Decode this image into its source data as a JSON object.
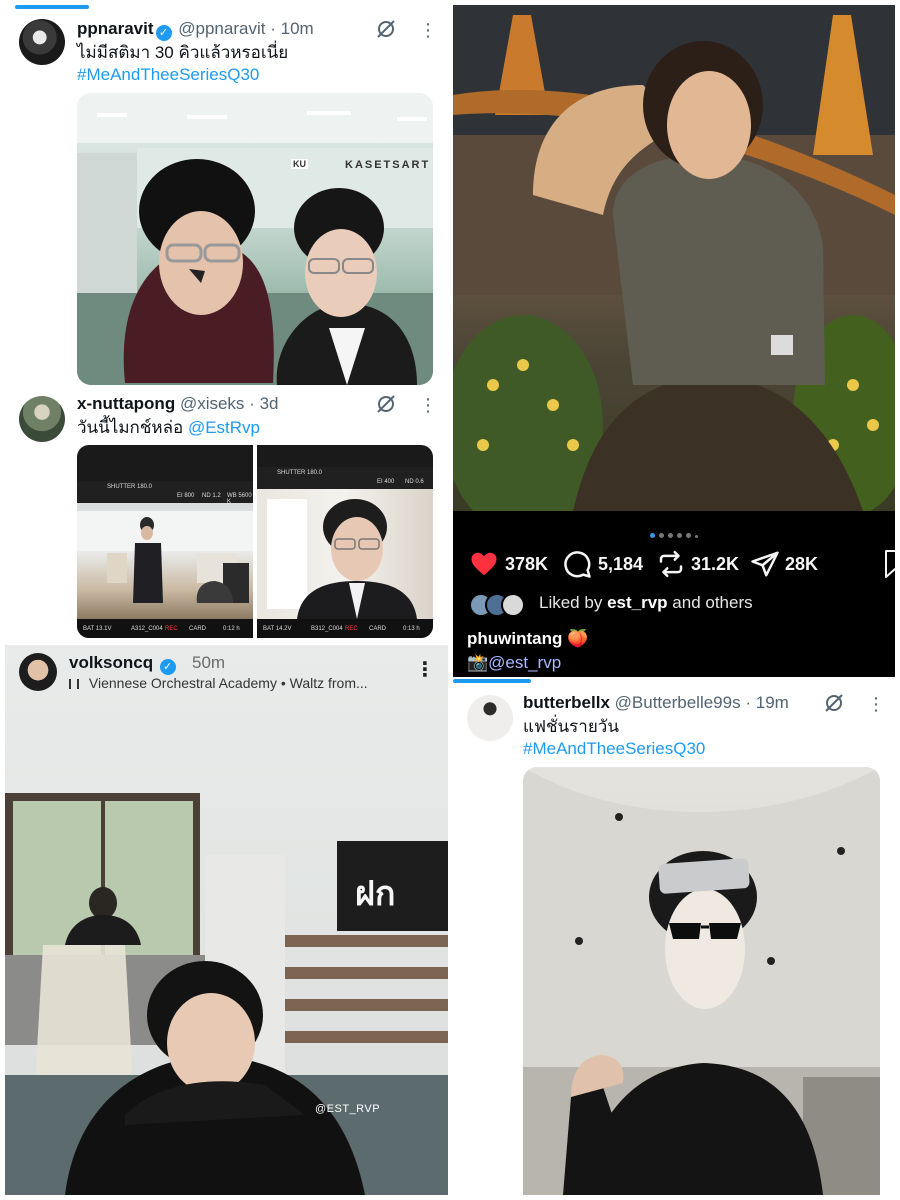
{
  "tweet1": {
    "name": "ppnaravit",
    "handle": "@ppnaravit",
    "dot": "·",
    "time": "10m",
    "text": "ไม่มีสติมา 30 คิวแล้วหรอเนี่ย",
    "hashtag": "#MeAndTheeSeriesQ30",
    "sign_ku": "KU",
    "sign_kasetsart": "KASETSART"
  },
  "tweet2": {
    "name": "x-nuttapong",
    "handle": "@xiseks",
    "dot": "·",
    "time": "3d",
    "text": "วันนี้ไมกช์หล่อ",
    "mention": "@EstRvp",
    "monitor1": {
      "shutter": "SHUTTER 180.0",
      "ei": "EI 800",
      "nd": "ND 1.2",
      "wb": "WB 5600 K",
      "bat": "BAT 13.1V",
      "clip": "A312_C004",
      "rec": "REC",
      "card": "CARD",
      "tc": "0:12 h"
    },
    "monitor2": {
      "shutter": "SHUTTER 180.0",
      "ei": "EI 400",
      "nd": "ND 0.6",
      "bat": "BAT 14.2V",
      "clip": "B312_C004",
      "rec": "REC",
      "card": "CARD",
      "tc": "0:13 h"
    }
  },
  "instagram": {
    "likes": "378K",
    "comments": "5,184",
    "reposts": "31.2K",
    "shares": "28K",
    "liked_by_prefix": "Liked by",
    "liked_by_user": "est_rvp",
    "liked_by_suffix": "and others",
    "caption_user": "phuwintang",
    "caption_emoji": "🍑",
    "tag_emoji": "📸",
    "tag": "@est_rvp",
    "like_color": "#ff3040"
  },
  "threads": {
    "name": "volksoncq",
    "time": "50m",
    "music": "Viennese Orchestral Academy • Waltz from...",
    "watermark": "@EST_RVP",
    "more": "⋮"
  },
  "tweet3": {
    "name": "butterbellx",
    "handle": "@Butterbelle99s",
    "dot": "·",
    "time": "19m",
    "text": "แฟชั่นรายวัน",
    "hashtag": "#MeAndTheeSeriesQ30"
  },
  "colors": {
    "twitter_blue": "#1d9bf0",
    "verified_blue": "#1d9bf0",
    "text_gray": "#536471"
  },
  "icons": {
    "verified": "✓",
    "more": "⋮"
  }
}
